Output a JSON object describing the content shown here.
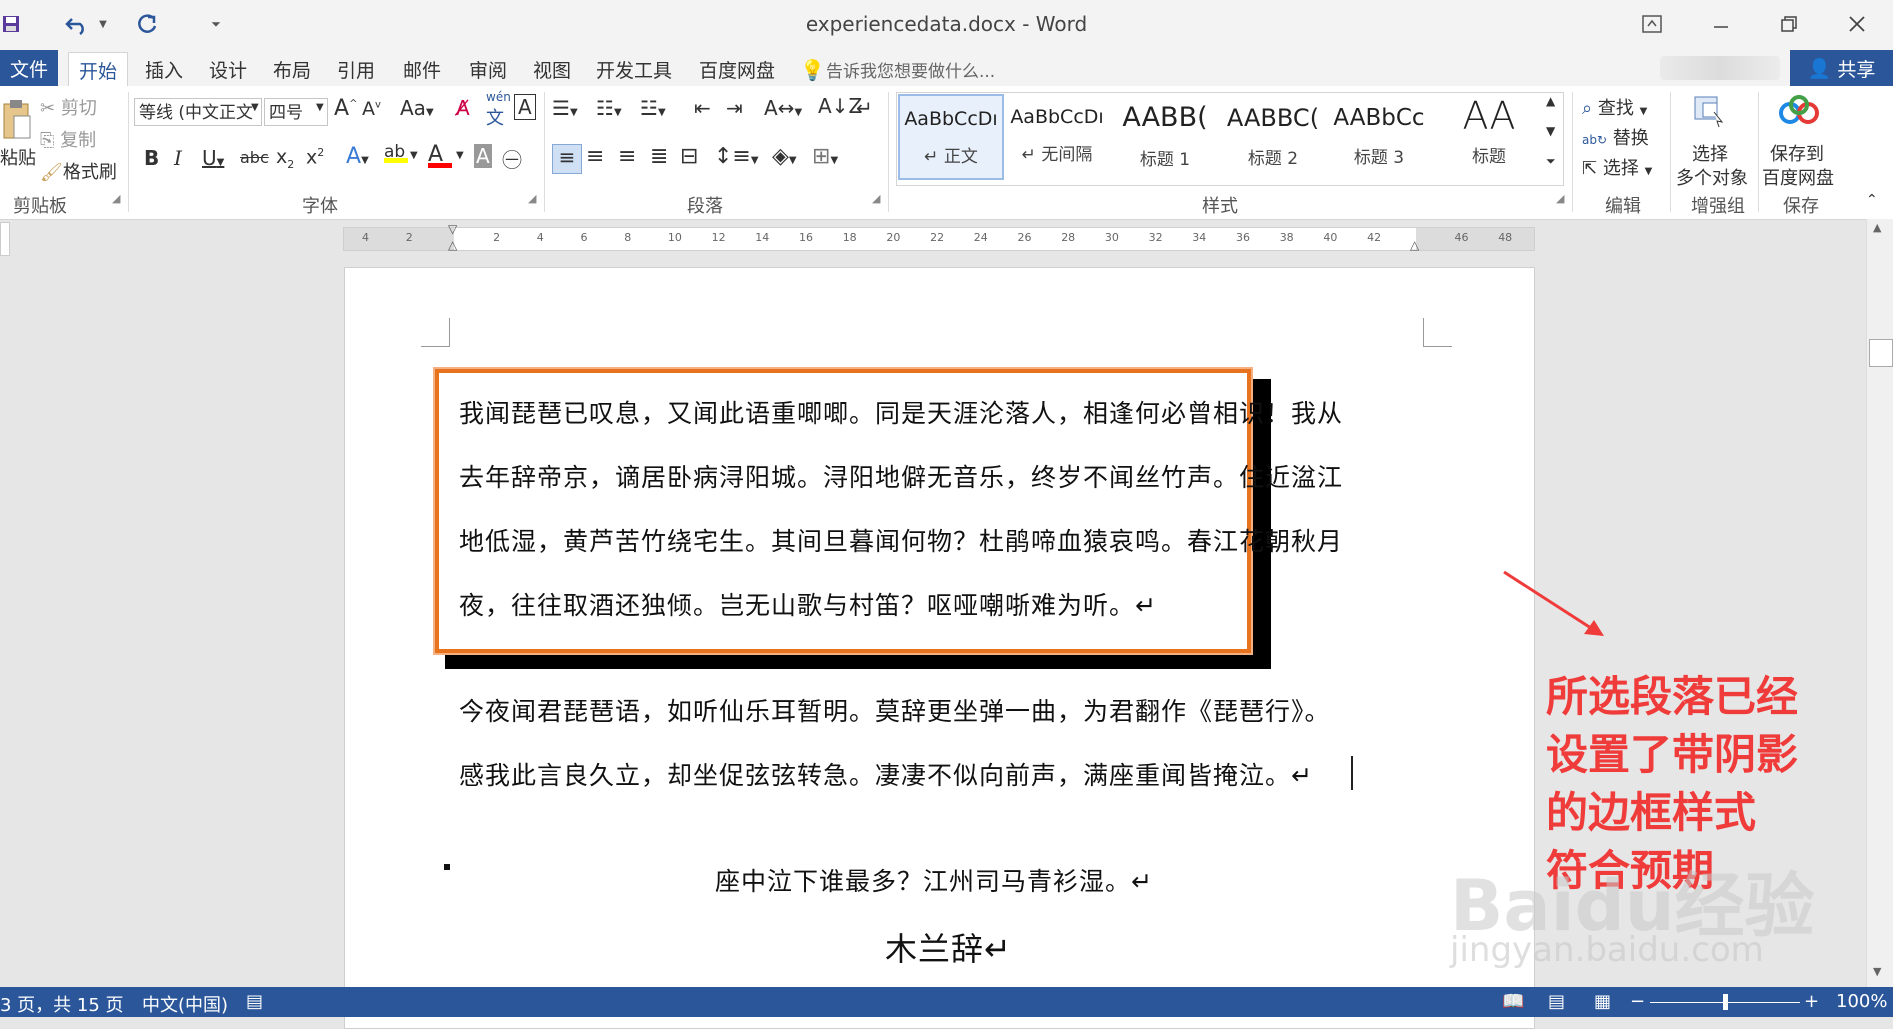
{
  "window": {
    "title": "experiencedata.docx - Word",
    "controls": [
      "ribbon-display",
      "minimize",
      "restore",
      "close"
    ]
  },
  "quick_access": {
    "save_icon": "save-icon",
    "undo_icon": "undo-icon",
    "redo_icon": "redo-icon"
  },
  "tabs": {
    "file": "文件",
    "home": "开始",
    "insert": "插入",
    "design": "设计",
    "layout": "布局",
    "references": "引用",
    "mailings": "邮件",
    "review": "审阅",
    "view": "视图",
    "developer": "开发工具",
    "baidu": "百度网盘",
    "tell_me": "告诉我您想要做什么...",
    "share": "共享"
  },
  "clipboard": {
    "paste": "粘贴",
    "cut": "剪切",
    "copy": "复制",
    "format_painter": "格式刷",
    "label": "剪贴板"
  },
  "font": {
    "name": "等线 (中文正文",
    "size": "四号",
    "label": "字体",
    "aa": "Aa",
    "wen": "wén"
  },
  "paragraph": {
    "label": "段落"
  },
  "styles": {
    "label": "样式",
    "items": [
      {
        "sample": "AaBbCcDı",
        "name": "正文"
      },
      {
        "sample": "AaBbCcDı",
        "name": "无间隔"
      },
      {
        "sample": "AABB(",
        "name": "标题 1"
      },
      {
        "sample": "AABBC(",
        "name": "标题 2"
      },
      {
        "sample": "AABbCc",
        "name": "标题 3"
      },
      {
        "sample": "AA",
        "name": "标题"
      }
    ]
  },
  "editing": {
    "find": "查找",
    "replace": "替换",
    "select": "选择",
    "label": "编辑"
  },
  "enhance": {
    "select_multi_1": "选择",
    "select_multi_2": "多个对象",
    "label": "增强组"
  },
  "save_group": {
    "save_1": "保存到",
    "save_2": "百度网盘",
    "label": "保存"
  },
  "ruler": {
    "ticks": [
      "4",
      "2",
      "",
      "2",
      "4",
      "6",
      "8",
      "10",
      "12",
      "14",
      "16",
      "18",
      "20",
      "22",
      "24",
      "26",
      "28",
      "30",
      "32",
      "34",
      "36",
      "38",
      "40",
      "42",
      "",
      "46",
      "48"
    ]
  },
  "document": {
    "bordered_paragraph": [
      "我闻琵琶已叹息，又闻此语重唧唧。同是天涯沦落人，相逢何必曾相识！我从",
      "去年辞帝京，谪居卧病浔阳城。浔阳地僻无音乐，终岁不闻丝竹声。住近湓江",
      "地低湿，黄芦苦竹绕宅生。其间旦暮闻何物？杜鹃啼血猿哀鸣。春江花朝秋月",
      "夜，往往取酒还独倾。岂无山歌与村笛？呕哑嘲哳难为听。↵"
    ],
    "paragraph2": [
      "今夜闻君琵琶语，如听仙乐耳暂明。莫辞更坐弹一曲，为君翻作《琵琶行》。",
      "感我此言良久立，却坐促弦弦转急。凄凄不似向前声，满座重闻皆掩泣。↵"
    ],
    "centered_line": "座中泣下谁最多？江州司马青衫湿。↵",
    "heading": "木兰辞↵"
  },
  "annotation": {
    "lines": [
      "所选段落已经",
      "设置了带阴影",
      "的边框样式",
      "符合预期"
    ],
    "color": "#f03b3b"
  },
  "watermark": {
    "brand": "Baidu经验",
    "url": "jingyan.baidu.com"
  },
  "status": {
    "page": "3 页，共 15 页",
    "language": "中文(中国)",
    "zoom": "100%",
    "zoom_level": 1.0
  },
  "colors": {
    "accent": "#2b579a",
    "border_orange": "#e8731f",
    "shadow": "#000000",
    "highlight": "#ffff00",
    "font_red": "#ff0000"
  }
}
